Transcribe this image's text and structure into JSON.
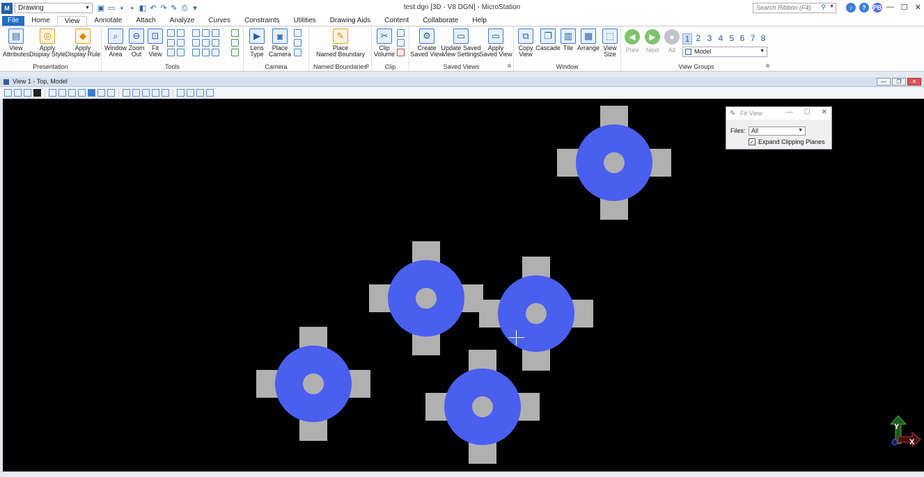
{
  "titlebar": {
    "workflow": "Drawing",
    "window_title": "test.dgn [3D - V8 DGN] - MicroStation",
    "search_placeholder": "Search Ribbon (F4)",
    "user_initials": "PB"
  },
  "tabs": [
    "File",
    "Home",
    "View",
    "Annotate",
    "Attach",
    "Analyze",
    "Curves",
    "Constraints",
    "Utilities",
    "Drawing Aids",
    "Content",
    "Collaborate",
    "Help"
  ],
  "active_tab": "View",
  "ribbon": {
    "presentation": {
      "label": "Presentation",
      "view_attributes": "View\nAttributes",
      "apply_display_style": "Apply\nDisplay Style",
      "apply_display_rule": "Apply\nDisplay Rule"
    },
    "tools": {
      "label": "Tools",
      "window_area": "Window\nArea",
      "zoom_out": "Zoom\nOut",
      "fit_view": "Fit\nView"
    },
    "camera": {
      "label": "Camera",
      "lens_type": "Lens\nType",
      "place_camera": "Place\nCamera"
    },
    "named_boundaries": {
      "label": "Named Boundaries",
      "place_named_boundary": "Place\nNamed Boundary"
    },
    "clip": {
      "label": "Clip",
      "clip_volume": "Clip\nVolume"
    },
    "saved_views": {
      "label": "Saved Views",
      "create_saved_view": "Create\nSaved View",
      "update_saved_view_settings": "Update Saved\nView Settings",
      "apply_saved_view": "Apply\nSaved View"
    },
    "window": {
      "label": "Window",
      "copy_view": "Copy\nView",
      "cascade": "Cascade",
      "tile": "Tile",
      "arrange": "Arrange",
      "view_size": "View\nSize"
    },
    "view_groups": {
      "label": "View Groups",
      "prev": "Prev",
      "next": "Next",
      "all": "All",
      "view_numbers": [
        "1",
        "2",
        "3",
        "4",
        "5",
        "6",
        "7",
        "8"
      ],
      "group_select": "Model"
    }
  },
  "view_window": {
    "title": "View 1 - Top, Model"
  },
  "axis": {
    "y": "Y",
    "x": "X"
  },
  "fit_view_dialog": {
    "title": "Fit View",
    "files_label": "Files:",
    "files_value": "All",
    "expand_clipping_label": "Expand Clipping Planes",
    "expand_clipping_checked": true
  },
  "colors": {
    "canvas": "#000000",
    "disc": "#4a5ff0",
    "tab_gray": "#b0b0b0",
    "file_tab": "#1f6fc5"
  }
}
